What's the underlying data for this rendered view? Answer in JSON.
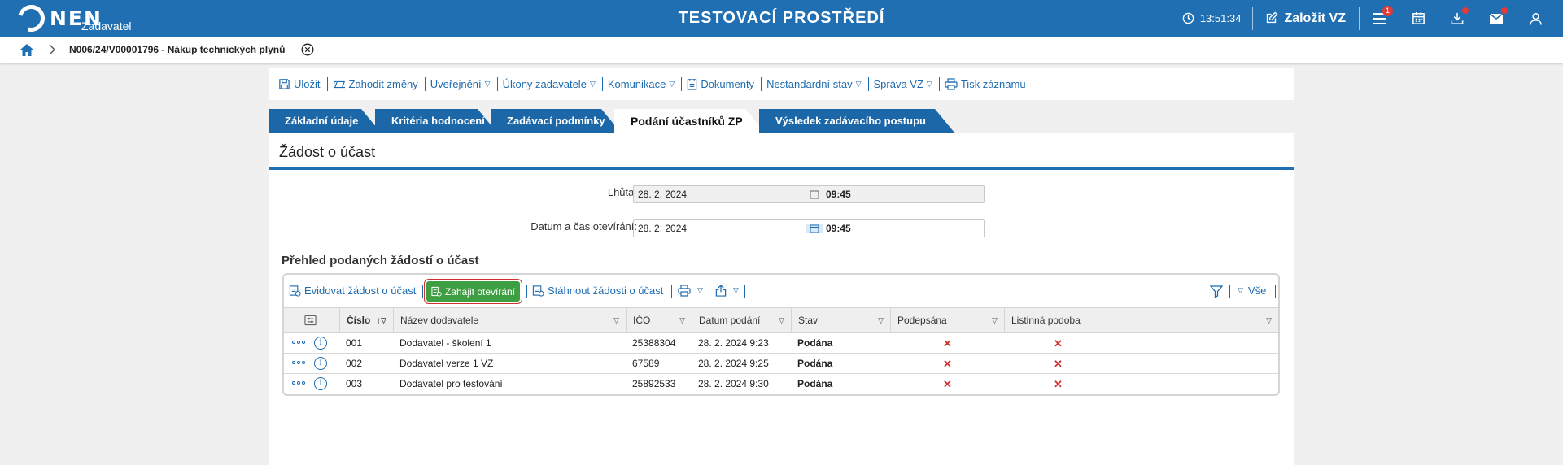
{
  "header": {
    "logo_text": "NEN",
    "logo_sub": "Zadavatel",
    "env_title": "TESTOVACÍ PROSTŘEDÍ",
    "time": "13:51:34",
    "create_label": "Založit VZ",
    "menu_badge": "1",
    "icons": [
      "clock-icon",
      "edit-icon",
      "menu-icon",
      "calendar-icon",
      "download-icon",
      "mail-icon",
      "user-icon"
    ],
    "bg_color": "#1f6fb2"
  },
  "breadcrumb": {
    "title": "N006/24/V00001796 - Nákup technických plynů"
  },
  "toolbar": {
    "items": [
      {
        "label": "Uložit",
        "caret": false
      },
      {
        "label": "Zahodit změny",
        "caret": false
      },
      {
        "label": "Uveřejnění",
        "caret": true
      },
      {
        "label": "Úkony zadavatele",
        "caret": true
      },
      {
        "label": "Komunikace",
        "caret": true
      },
      {
        "label": "Dokumenty",
        "caret": false
      },
      {
        "label": "Nestandardní stav",
        "caret": true
      },
      {
        "label": "Správa VZ",
        "caret": true
      },
      {
        "label": "Tisk záznamu",
        "caret": false
      }
    ]
  },
  "tabs": [
    {
      "label": "Základní údaje",
      "active": false
    },
    {
      "label": "Kritéria hodnocení",
      "active": false
    },
    {
      "label": "Zadávací podmínky",
      "active": false
    },
    {
      "label": "Podání účastníků ZP",
      "active": true
    },
    {
      "label": "Výsledek zadávacího postupu",
      "active": false
    }
  ],
  "section": {
    "title": "Žádost o účast"
  },
  "form": {
    "deadline_label": "Lhůta:",
    "deadline_date": "28. 2. 2024",
    "deadline_time": "09:45",
    "opening_label": "Datum a čas otevírání:",
    "opening_date": "28. 2. 2024",
    "opening_time": "09:45"
  },
  "list": {
    "title": "Přehled podaných žádostí o účast",
    "toolbar": {
      "register_label": "Evidovat žádost o účast",
      "start_label": "Zahájit otevírání",
      "download_label": "Stáhnout žádosti o účast",
      "filter_all_label": "Vše"
    },
    "columns": [
      "Číslo",
      "Název dodavatele",
      "IČO",
      "Datum podání",
      "Stav",
      "Podepsána",
      "Listinná podoba"
    ],
    "rows": [
      {
        "number": "001",
        "supplier": "Dodavatel - školení 1",
        "ico": "25388304",
        "date": "28. 2. 2024 9:23",
        "state": "Podána",
        "signed": "✕",
        "paper": "✕"
      },
      {
        "number": "002",
        "supplier": "Dodavatel verze 1 VZ",
        "ico": "67589",
        "date": "28. 2. 2024 9:25",
        "state": "Podána",
        "signed": "✕",
        "paper": "✕"
      },
      {
        "number": "003",
        "supplier": "Dodavatel pro testování",
        "ico": "25892533",
        "date": "28. 2. 2024 9:30",
        "state": "Podána",
        "signed": "✕",
        "paper": "✕"
      }
    ]
  }
}
